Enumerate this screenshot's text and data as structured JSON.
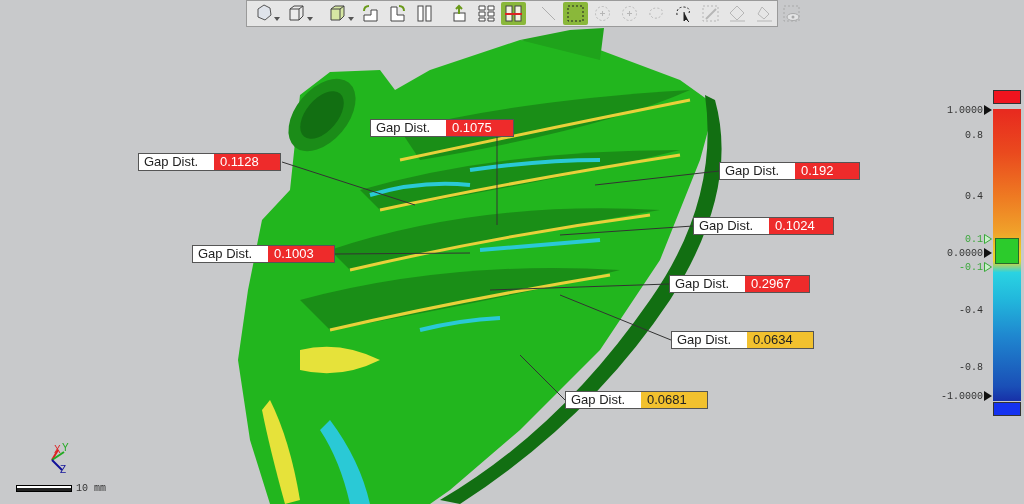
{
  "toolbar": [
    {
      "kind": "polyhedron",
      "dropdown": true,
      "selected": false,
      "disabled": false
    },
    {
      "kind": "cube",
      "dropdown": true,
      "selected": false,
      "disabled": false
    },
    {
      "kind": "wirecube",
      "dropdown": true,
      "selected": false,
      "disabled": false
    },
    {
      "kind": "rotleft",
      "dropdown": false,
      "selected": false,
      "disabled": false
    },
    {
      "kind": "rotright",
      "dropdown": false,
      "selected": false,
      "disabled": false
    },
    {
      "kind": "mirror",
      "dropdown": false,
      "selected": false,
      "disabled": false
    },
    {
      "kind": "lift",
      "dropdown": false,
      "selected": false,
      "disabled": false
    },
    {
      "kind": "grid",
      "dropdown": false,
      "selected": false,
      "disabled": false
    },
    {
      "kind": "compare",
      "dropdown": false,
      "selected": true,
      "disabled": false
    },
    {
      "kind": "line",
      "dropdown": false,
      "selected": false,
      "disabled": true
    },
    {
      "kind": "rect",
      "dropdown": false,
      "selected": true,
      "disabled": false
    },
    {
      "kind": "circleplus",
      "dropdown": false,
      "selected": false,
      "disabled": true
    },
    {
      "kind": "circleplus",
      "dropdown": false,
      "selected": false,
      "disabled": true
    },
    {
      "kind": "lasso",
      "dropdown": false,
      "selected": false,
      "disabled": true
    },
    {
      "kind": "lassopointer",
      "dropdown": false,
      "selected": false,
      "disabled": false
    },
    {
      "kind": "brush",
      "dropdown": false,
      "selected": false,
      "disabled": true
    },
    {
      "kind": "bucket",
      "dropdown": false,
      "selected": false,
      "disabled": true
    },
    {
      "kind": "eraser",
      "dropdown": false,
      "selected": false,
      "disabled": true
    },
    {
      "kind": "eye",
      "dropdown": false,
      "selected": false,
      "disabled": true
    }
  ],
  "callouts": [
    {
      "label": "Gap Dist.",
      "value": "0.1075",
      "color": "#ee2b2b"
    },
    {
      "label": "Gap Dist.",
      "value": "0.1128",
      "color": "#ee2b2b"
    },
    {
      "label": "Gap Dist.",
      "value": "0.192",
      "color": "#ee2b2b"
    },
    {
      "label": "Gap Dist.",
      "value": "0.1024",
      "color": "#ee2b2b"
    },
    {
      "label": "Gap Dist.",
      "value": "0.1003",
      "color": "#ee2b2b"
    },
    {
      "label": "Gap Dist.",
      "value": "0.2967",
      "color": "#ee2b2b"
    },
    {
      "label": "Gap Dist.",
      "value": "0.0634",
      "color": "#f2c12e"
    },
    {
      "label": "Gap Dist.",
      "value": "0.0681",
      "color": "#f2c12e"
    }
  ],
  "color_scale": {
    "labels": [
      {
        "text": "1.0000",
        "kind": "major"
      },
      {
        "text": "0.8",
        "kind": "minor"
      },
      {
        "text": "0.4",
        "kind": "minor"
      },
      {
        "text": "0.1",
        "kind": "tolerance"
      },
      {
        "text": "0.0000",
        "kind": "major"
      },
      {
        "text": "-0.1",
        "kind": "tolerance"
      },
      {
        "text": "-0.4",
        "kind": "minor"
      },
      {
        "text": "-0.8",
        "kind": "minor"
      },
      {
        "text": "-1.0000",
        "kind": "major"
      }
    ]
  },
  "triad": {
    "axis_labels": [
      "X",
      "Y",
      "Z"
    ]
  },
  "scale_bar": {
    "label": "10 mm"
  }
}
